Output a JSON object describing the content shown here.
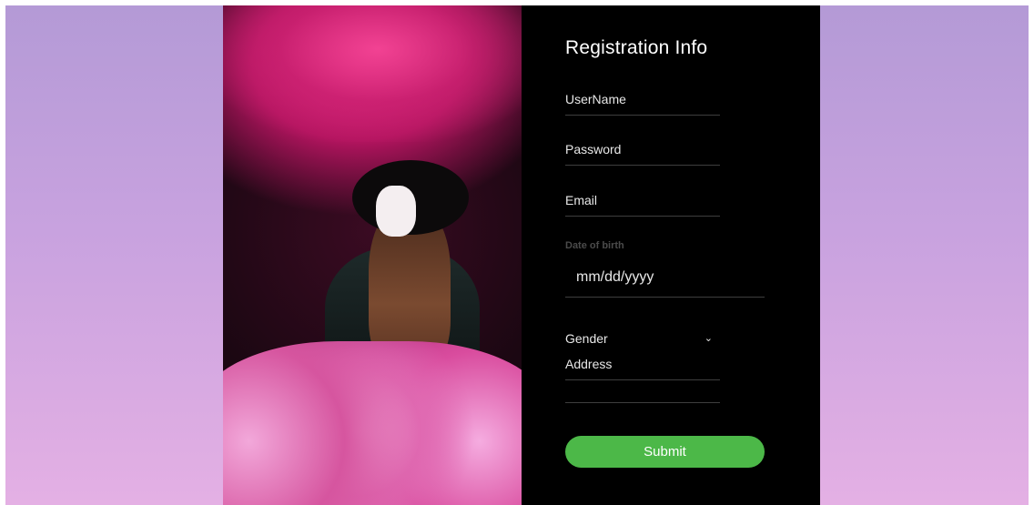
{
  "form": {
    "title": "Registration Info",
    "username_placeholder": "UserName",
    "password_placeholder": "Password",
    "email_placeholder": "Email",
    "dob_label": "Date of birth",
    "dob_placeholder": "mm/dd/yyyy",
    "gender_selected": "Gender",
    "address_placeholder": "Address",
    "submit_label": "Submit"
  },
  "colors": {
    "submit": "#4cb848",
    "form_background": "#000000",
    "page_gradient_top": "#b49ad6",
    "page_gradient_bottom": "#e4b0e4"
  },
  "icons": {
    "gender_dropdown": "chevron-down-icon"
  }
}
